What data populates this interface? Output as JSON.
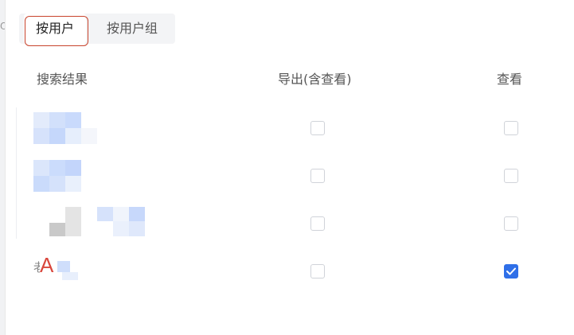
{
  "tabs": [
    {
      "label": "按用户",
      "active": true
    },
    {
      "label": "按用户组",
      "active": false
    }
  ],
  "table": {
    "columns": {
      "results": "搜索结果",
      "export": "导出(含查看)",
      "view": "查看"
    },
    "rows": [
      {
        "export_checked": false,
        "view_checked": false
      },
      {
        "export_checked": false,
        "view_checked": false
      },
      {
        "export_checked": false,
        "view_checked": false
      },
      {
        "label": "A",
        "export_checked": false,
        "view_checked": true
      }
    ]
  },
  "colors": {
    "accent": "#2f6fe8",
    "highlight_outline": "#c8442d",
    "annotation_letter": "#d9473d"
  }
}
